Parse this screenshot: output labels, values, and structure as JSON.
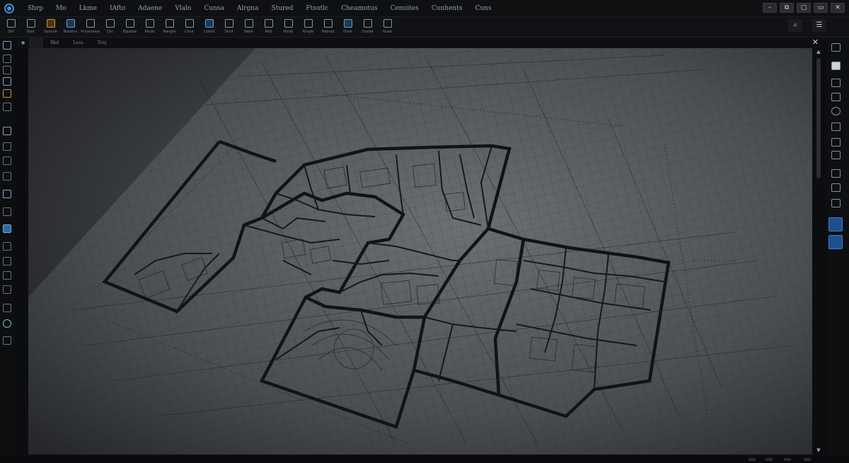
{
  "app": {
    "accent_color": "#3f8fd1"
  },
  "menu": [
    "Shrp",
    "Mo",
    "Lkme",
    "IAfto",
    "Adaene",
    "Vlalo",
    "Cunsa",
    "Alrgna",
    "Stured",
    "Ftsutlc",
    "Cheamotus",
    "Cenuites",
    "Cunhents",
    "Cuns"
  ],
  "window_controls": [
    "–",
    "⧉",
    "▢",
    "▭",
    "✕"
  ],
  "ribbon": {
    "tools": [
      {
        "icon": "save-icon",
        "label": "Stlt"
      },
      {
        "icon": "page-icon",
        "label": "Bskt"
      },
      {
        "icon": "layers-icon",
        "label": "Somule"
      },
      {
        "icon": "wall-icon",
        "label": "Ntadhrs"
      },
      {
        "icon": "room-icon",
        "label": "Prsosnlase"
      },
      {
        "icon": "circle-icon",
        "label": "Cbc"
      },
      {
        "icon": "grid-icon",
        "label": "Equalze"
      },
      {
        "icon": "stack-icon",
        "label": "Pkute"
      },
      {
        "icon": "door-icon",
        "label": "Rangte"
      },
      {
        "icon": "window-icon",
        "label": "Cnce"
      },
      {
        "icon": "stair-icon",
        "label": "Coktd"
      },
      {
        "icon": "tag-icon",
        "label": "Strut"
      },
      {
        "icon": "globe-icon",
        "label": "Neke"
      },
      {
        "icon": "box-icon",
        "label": "Rltd"
      },
      {
        "icon": "frame-icon",
        "label": "Rlrdd"
      },
      {
        "icon": "wall-icon",
        "label": "Rsrgle"
      },
      {
        "icon": "roof-icon",
        "label": "Fatinad"
      },
      {
        "icon": "measure-icon",
        "label": "Hulle"
      },
      {
        "icon": "dim-icon",
        "label": "Snette"
      },
      {
        "icon": "area-icon",
        "label": "Nuoe"
      }
    ],
    "search_glyph": "⌕",
    "menu_glyph": "☰"
  },
  "doc_tabs": [
    "",
    "Bkd",
    "Laus",
    "Teoj"
  ],
  "canvas": {
    "tab_close": "✕"
  },
  "scroll": {
    "up": "▲",
    "down": "▼"
  }
}
